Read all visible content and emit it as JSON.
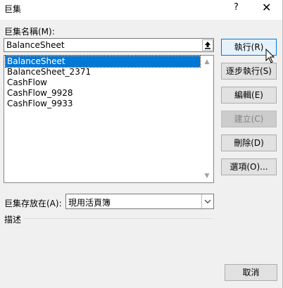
{
  "window": {
    "title": "巨集",
    "help_glyph": "?",
    "close_glyph": "✕"
  },
  "macro_name": {
    "label": "巨集名稱(M):",
    "value": "BalanceSheet"
  },
  "macro_list": {
    "items": [
      "BalanceSheet",
      "BalanceSheet_2371",
      "CashFlow",
      "CashFlow_9928",
      "CashFlow_9933"
    ],
    "selected": "BalanceSheet"
  },
  "buttons": {
    "run": "執行(R)",
    "step_into": "逐步執行(S)",
    "edit": "編輯(E)",
    "create": "建立(C)",
    "delete": "刪除(D)",
    "options": "選項(O)...",
    "cancel": "取消"
  },
  "store_in": {
    "label": "巨集存放在(A):",
    "value": "現用活頁簿"
  },
  "description": {
    "label": "描述"
  },
  "colors": {
    "selection": "#0078d7",
    "dialog_bg": "#f0f0f0"
  }
}
